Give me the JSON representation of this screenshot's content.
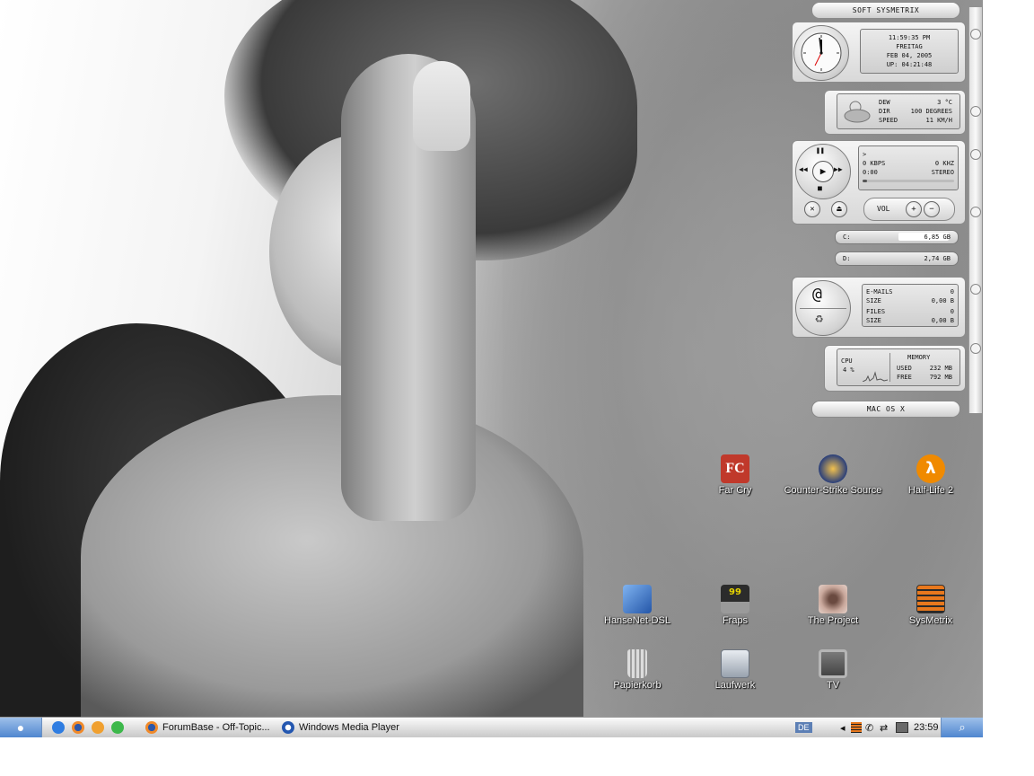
{
  "widget": {
    "header": "SOFT SYSMETRIX",
    "footer": "MAC OS X",
    "clock": {
      "time": "11:59:35 PM",
      "day": "FREITAG",
      "date": "FEB 04, 2005",
      "uptime": "UP: 04:21:48"
    },
    "weather": {
      "dew_label": "DEW",
      "dew_value": "3 °C",
      "dir_label": "DIR",
      "dir_value": "100 DEGREES",
      "speed_label": "SPEED",
      "speed_value": "11 KM/H"
    },
    "player": {
      "status": ">",
      "kbps": "0 KBPS",
      "khz": "0 KHZ",
      "pos": "0:00",
      "mode": "STEREO",
      "vol_label": "VOL",
      "progress": 0.05
    },
    "drives": [
      {
        "label": "C:",
        "value": "6,85 GB"
      },
      {
        "label": "D:",
        "value": "2,74 GB"
      }
    ],
    "mail": {
      "emails_label": "E-MAILS",
      "emails_value": "0",
      "size_label": "SIZE",
      "size_value": "0,00 B",
      "files_label": "FILES",
      "files_value": "0",
      "size2_label": "SIZE",
      "size2_value": "0,00 B"
    },
    "system": {
      "cpu_label": "CPU",
      "cpu_value": "4 %",
      "memory_label": "MEMORY",
      "used_label": "USED",
      "used_value": "232 MB",
      "free_label": "FREE",
      "free_value": "792 MB"
    }
  },
  "desktop_icons": [
    {
      "label": "Far Cry",
      "icon": "farcry-icon",
      "color": "#c0392b"
    },
    {
      "label": "Counter-Strike Source",
      "icon": "counter-strike-icon",
      "color": "#e0a020"
    },
    {
      "label": "Half-Life 2",
      "icon": "half-life-icon",
      "color": "#f08a00"
    },
    {
      "label": "HanseNet-DSL",
      "icon": "network-icon",
      "color": "#3a6fc4"
    },
    {
      "label": "Fraps",
      "icon": "fraps-icon",
      "color": "#d6c300"
    },
    {
      "label": "The Project",
      "icon": "eye-icon",
      "color": "#b07a6a"
    },
    {
      "label": "SysMetrix",
      "icon": "sysmetrix-icon",
      "color": "#c46a1a"
    },
    {
      "label": "Papierkorb",
      "icon": "trash-icon",
      "color": "#bfbfbf"
    },
    {
      "label": "Laufwerk",
      "icon": "drive-icon",
      "color": "#aab2bd"
    },
    {
      "label": "TV",
      "icon": "tv-icon",
      "color": "#8c8c8c"
    }
  ],
  "taskbar": {
    "windows": [
      "ForumBase - Off-Topic...",
      "Windows Media Player"
    ],
    "lang": "DE",
    "time": "23:59"
  }
}
